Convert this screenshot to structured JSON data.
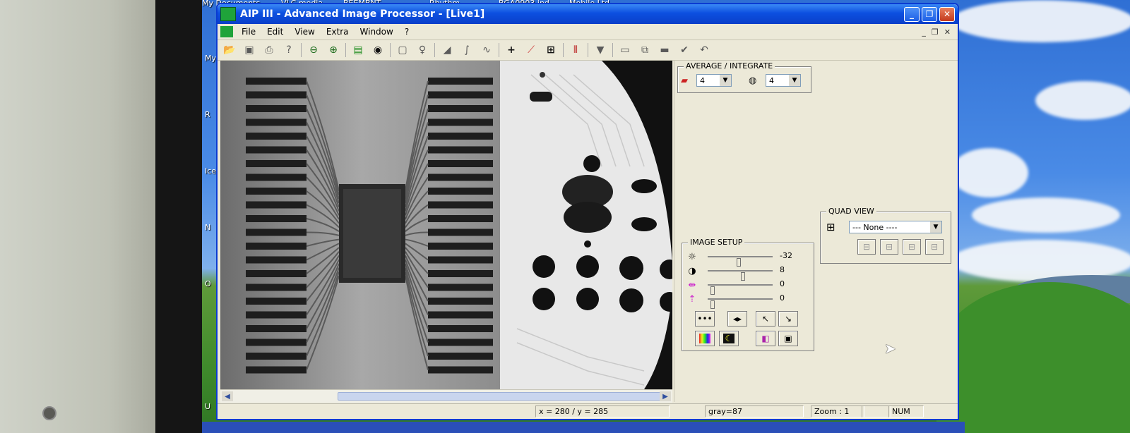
{
  "window": {
    "title": "AIP III - Advanced Image Processor - [Live1]"
  },
  "menu": [
    "File",
    "Edit",
    "View",
    "Extra",
    "Window",
    "?"
  ],
  "desktop": {
    "top_labels": [
      "My Documents",
      "VLC media",
      "BEEMBNT",
      "Rhythm",
      "BGA0903.ind",
      "Mobile Ltd"
    ],
    "side_labels": [
      "My",
      "R",
      "Ice",
      "N",
      "O",
      "U"
    ]
  },
  "toolbar_icons": [
    "folder-open-icon",
    "save-icon",
    "print-icon",
    "help-icon",
    "zoom-out-icon",
    "zoom-in-icon",
    "live-camera-icon",
    "camera-capture-icon",
    "snapshot-icon",
    "probe-icon",
    "ramp-icon",
    "curve-icon",
    "curve-alt-icon",
    "crosshair-icon",
    "profile-icon",
    "quad-grid-icon",
    "stripes-icon",
    "filter-icon",
    "panel-icon",
    "compare-icon",
    "flat-icon",
    "check-icon",
    "undo-icon"
  ],
  "average": {
    "title": "AVERAGE / INTEGRATE",
    "average_value": "4",
    "integrate_value": "4"
  },
  "quad_view": {
    "title": "QUAD VIEW",
    "selected": "---  None  ----"
  },
  "image_setup": {
    "title": "IMAGE SETUP",
    "sliders": [
      {
        "icon": "brightness-icon",
        "value": "-32",
        "level": 0.48
      },
      {
        "icon": "contrast-icon",
        "value": "8",
        "level": 0.55
      },
      {
        "icon": "gamma-icon",
        "value": "0",
        "level": 0.05
      },
      {
        "icon": "offset-icon",
        "value": "0",
        "level": 0.05
      }
    ],
    "buttons_row1": [
      "dots-icon",
      "flip-icon",
      "cursor-icon",
      "cursor-alt-icon"
    ],
    "buttons_row2": [
      "palette-icon",
      "moon-icon",
      "invert-icon",
      "cube-icon"
    ]
  },
  "status": {
    "coords": "x = 280  / y = 285",
    "gray": "gray=87",
    "zoom": "Zoom : 1",
    "num": "NUM"
  }
}
